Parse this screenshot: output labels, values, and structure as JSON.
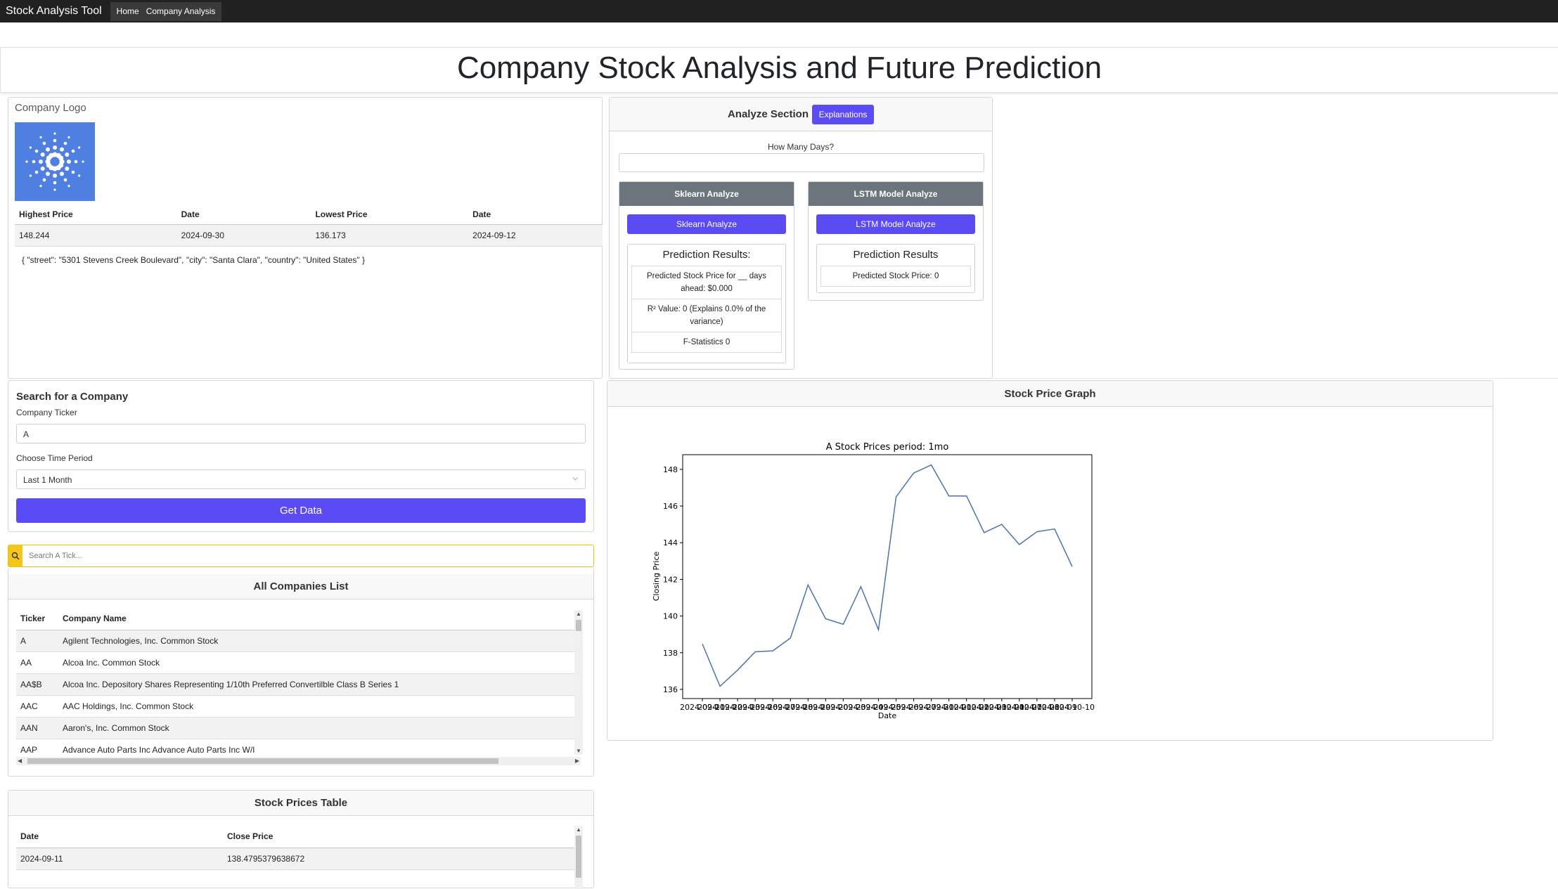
{
  "navbar": {
    "brand": "Stock Analysis Tool",
    "links": [
      "Home",
      "Company Analysis"
    ]
  },
  "page": {
    "title": "Company Stock Analysis and Future Prediction"
  },
  "company": {
    "logo_label": "Company Logo",
    "table": {
      "headers": [
        "Highest Price",
        "Date",
        "Lowest Price",
        "Date"
      ],
      "row": [
        "148.244",
        "2024-09-30",
        "136.173",
        "2024-09-12"
      ]
    },
    "address": "{ \"street\": \"5301 Stevens Creek Boulevard\", \"city\": \"Santa Clara\", \"country\": \"United States\" }"
  },
  "analyze": {
    "title": "Analyze Section",
    "explanations_button": "Explanations",
    "days_label": "How Many Days?",
    "days_value": "",
    "sklearn": {
      "header": "Sklearn Analyze",
      "button": "Sklearn Analyze",
      "results_title": "Prediction Results:",
      "predicted": "Predicted Stock Price for __ days ahead: $0.000",
      "r2": "R² Value: 0 (Explains 0.0% of the variance)",
      "f_stat": "F-Statistics 0"
    },
    "lstm": {
      "header": "LSTM Model Analyze",
      "button": "LSTM Model Analyze",
      "results_title": "Prediction Results",
      "predicted": "Predicted Stock Price: 0"
    }
  },
  "search": {
    "title": "Search for a Company",
    "ticker_label": "Company Ticker",
    "ticker_value": "A",
    "period_label": "Choose Time Period",
    "period_value": "Last 1 Month",
    "get_button": "Get Data"
  },
  "companies": {
    "search_placeholder": "Search A Tick...",
    "title": "All Companies List",
    "headers": [
      "Ticker",
      "Company Name"
    ],
    "rows": [
      [
        "A",
        "Agilent Technologies, Inc. Common Stock"
      ],
      [
        "AA",
        "Alcoa Inc. Common Stock"
      ],
      [
        "AA$B",
        "Alcoa Inc. Depository Shares Representing 1/10th Preferred Convertilble Class B Series 1"
      ],
      [
        "AAC",
        "AAC Holdings, Inc. Common Stock"
      ],
      [
        "AAN",
        "Aaron's, Inc. Common Stock"
      ],
      [
        "AAP",
        "Advance Auto Parts Inc Advance Auto Parts Inc W/I"
      ]
    ]
  },
  "prices": {
    "title": "Stock Prices Table",
    "headers": [
      "Date",
      "Close Price"
    ],
    "rows": [
      [
        "2024-09-11",
        "138.4795379638672"
      ]
    ]
  },
  "graph": {
    "header": "Stock Price Graph",
    "line_color": "#4c72b0"
  },
  "chart_data": {
    "type": "line",
    "title": "A Stock Prices period: 1mo",
    "xlabel": "Date",
    "ylabel": "Closing Price",
    "x": [
      "2024-09-11",
      "2024-09-12",
      "2024-09-13",
      "2024-09-16",
      "2024-09-17",
      "2024-09-18",
      "2024-09-19",
      "2024-09-20",
      "2024-09-23",
      "2024-09-24",
      "2024-09-25",
      "2024-09-26",
      "2024-09-27",
      "2024-09-30",
      "2024-10-01",
      "2024-10-02",
      "2024-10-03",
      "2024-10-04",
      "2024-10-07",
      "2024-10-08",
      "2024-10-09",
      "2024-10-10"
    ],
    "values": [
      138.48,
      136.17,
      137.05,
      138.05,
      138.1,
      138.8,
      141.7,
      139.85,
      139.55,
      141.6,
      139.25,
      146.5,
      147.8,
      148.24,
      146.55,
      146.55,
      144.55,
      145.0,
      143.9,
      144.6,
      144.75,
      142.7
    ],
    "yticks": [
      136,
      138,
      140,
      142,
      144,
      146,
      148
    ],
    "ylim": [
      135.5,
      148.8
    ],
    "xtick_labels": [
      "2024-09-11",
      "2024-09-12",
      "2024-09-13",
      "2024-09-16",
      "2024-09-17",
      "2024-09-18",
      "2024-09-19",
      "2024-09-20",
      "2024-09-23",
      "2024-09-24",
      "2024-09-25",
      "2024-09-26",
      "2024-09-27",
      "2024-09-30",
      "2024-10-01",
      "2024-10-02",
      "2024-10-03",
      "2024-10-04",
      "2024-10-07",
      "2024-10-08",
      "2024-10-09",
      "2024-10-10"
    ],
    "grid": false,
    "series": [
      {
        "values": [
          138.48,
          136.17,
          137.05,
          138.05,
          138.1,
          138.8,
          141.7,
          139.85,
          139.55,
          141.6,
          139.25,
          146.5,
          147.8,
          148.24,
          146.55,
          146.55,
          144.55,
          145.0,
          143.9,
          144.6,
          144.75,
          142.7
        ]
      }
    ]
  }
}
